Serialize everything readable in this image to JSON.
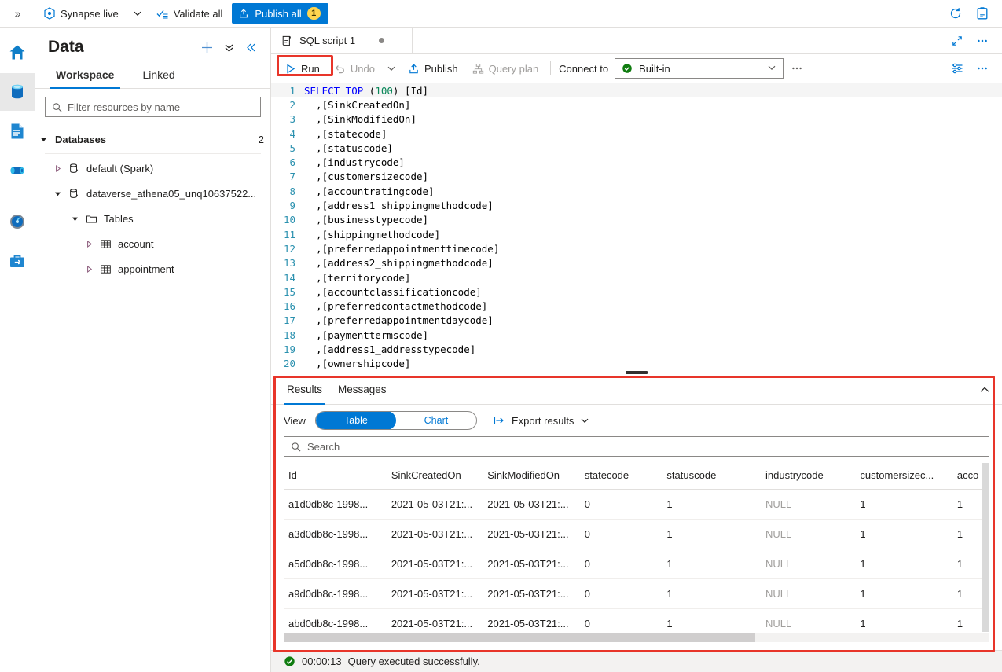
{
  "topbar": {
    "expand_icon": "chevron-double-right-icon",
    "mode_label": "Synapse live",
    "validate_label": "Validate all",
    "publish_label": "Publish all",
    "publish_badge": "1",
    "refresh_icon": "refresh-icon",
    "feedback_icon": "clipboard-icon",
    "accent": "#0078d4",
    "badge_color": "#ffd54f"
  },
  "rail": {
    "items": [
      {
        "name": "home-icon",
        "title": "Home"
      },
      {
        "name": "data-icon",
        "title": "Data",
        "active": true
      },
      {
        "name": "develop-icon",
        "title": "Develop"
      },
      {
        "name": "integrate-icon",
        "title": "Integrate"
      },
      {
        "name": "monitor-icon",
        "title": "Monitor"
      },
      {
        "name": "manage-icon",
        "title": "Manage"
      }
    ]
  },
  "panel": {
    "title": "Data",
    "actions": [
      "plus-icon",
      "chevron-double-down-icon",
      "chevron-double-left-icon"
    ],
    "tabs": [
      {
        "label": "Workspace",
        "active": true
      },
      {
        "label": "Linked",
        "active": false
      }
    ],
    "filter_placeholder": "Filter resources by name",
    "filter_value": "",
    "tree": {
      "group_label": "Databases",
      "group_count": "2",
      "nodes": [
        {
          "label": "default (Spark)",
          "icon": "database-icon",
          "expanded": false
        },
        {
          "label": "dataverse_athena05_unq10637522...",
          "icon": "database-icon",
          "expanded": true
        }
      ],
      "folder_label": "Tables",
      "tables": [
        {
          "label": "account"
        },
        {
          "label": "appointment"
        }
      ]
    }
  },
  "editor": {
    "tab_label": "SQL script 1",
    "tab_icon": "script-icon",
    "tab_dirty": true,
    "tab_actions": [
      "expand-icon",
      "more-icon"
    ],
    "toolbar": {
      "run_label": "Run",
      "undo_label": "Undo",
      "publish_label": "Publish",
      "query_plan_label": "Query plan",
      "connect_label": "Connect to",
      "connection_value": "Built-in",
      "more_label": "...",
      "right_actions": [
        "settings-sliders-icon",
        "more-icon"
      ]
    },
    "code": [
      {
        "n": "1",
        "text": "SELECT TOP (100) [Id]",
        "kw": "SELECT TOP",
        "num": "100",
        "rest": " [Id]"
      },
      {
        "n": "2",
        "text": "  ,[SinkCreatedOn]"
      },
      {
        "n": "3",
        "text": "  ,[SinkModifiedOn]"
      },
      {
        "n": "4",
        "text": "  ,[statecode]"
      },
      {
        "n": "5",
        "text": "  ,[statuscode]"
      },
      {
        "n": "6",
        "text": "  ,[industrycode]"
      },
      {
        "n": "7",
        "text": "  ,[customersizecode]"
      },
      {
        "n": "8",
        "text": "  ,[accountratingcode]"
      },
      {
        "n": "9",
        "text": "  ,[address1_shippingmethodcode]"
      },
      {
        "n": "10",
        "text": "  ,[businesstypecode]"
      },
      {
        "n": "11",
        "text": "  ,[shippingmethodcode]"
      },
      {
        "n": "12",
        "text": "  ,[preferredappointmenttimecode]"
      },
      {
        "n": "13",
        "text": "  ,[address2_shippingmethodcode]"
      },
      {
        "n": "14",
        "text": "  ,[territorycode]"
      },
      {
        "n": "15",
        "text": "  ,[accountclassificationcode]"
      },
      {
        "n": "16",
        "text": "  ,[preferredcontactmethodcode]"
      },
      {
        "n": "17",
        "text": "  ,[preferredappointmentdaycode]"
      },
      {
        "n": "18",
        "text": "  ,[paymenttermscode]"
      },
      {
        "n": "19",
        "text": "  ,[address1_addresstypecode]"
      },
      {
        "n": "20",
        "text": "  ,[ownershipcode]"
      }
    ]
  },
  "results": {
    "tabs": [
      {
        "label": "Results",
        "active": true
      },
      {
        "label": "Messages",
        "active": false
      }
    ],
    "collapse_icon": "chevron-up-icon",
    "view_label": "View",
    "view_options": [
      {
        "label": "Table",
        "selected": true
      },
      {
        "label": "Chart",
        "selected": false
      }
    ],
    "export_label": "Export results",
    "search_placeholder": "Search",
    "search_value": "",
    "columns": [
      "Id",
      "SinkCreatedOn",
      "SinkModifiedOn",
      "statecode",
      "statuscode",
      "industrycode",
      "customersizec...",
      "acco"
    ],
    "rows": [
      [
        "a1d0db8c-1998...",
        "2021-05-03T21:...",
        "2021-05-03T21:...",
        "0",
        "1",
        "NULL",
        "1",
        "1"
      ],
      [
        "a3d0db8c-1998...",
        "2021-05-03T21:...",
        "2021-05-03T21:...",
        "0",
        "1",
        "NULL",
        "1",
        "1"
      ],
      [
        "a5d0db8c-1998...",
        "2021-05-03T21:...",
        "2021-05-03T21:...",
        "0",
        "1",
        "NULL",
        "1",
        "1"
      ],
      [
        "a9d0db8c-1998...",
        "2021-05-03T21:...",
        "2021-05-03T21:...",
        "0",
        "1",
        "NULL",
        "1",
        "1"
      ],
      [
        "abd0db8c-1998...",
        "2021-05-03T21:...",
        "2021-05-03T21:...",
        "0",
        "1",
        "NULL",
        "1",
        "1"
      ]
    ]
  },
  "status": {
    "icon": "success-check-icon",
    "duration": "00:00:13",
    "message": "Query executed successfully."
  },
  "annotations": {
    "highlight_color": "#e8352a",
    "boxes": [
      "run-button",
      "results-panel"
    ]
  }
}
